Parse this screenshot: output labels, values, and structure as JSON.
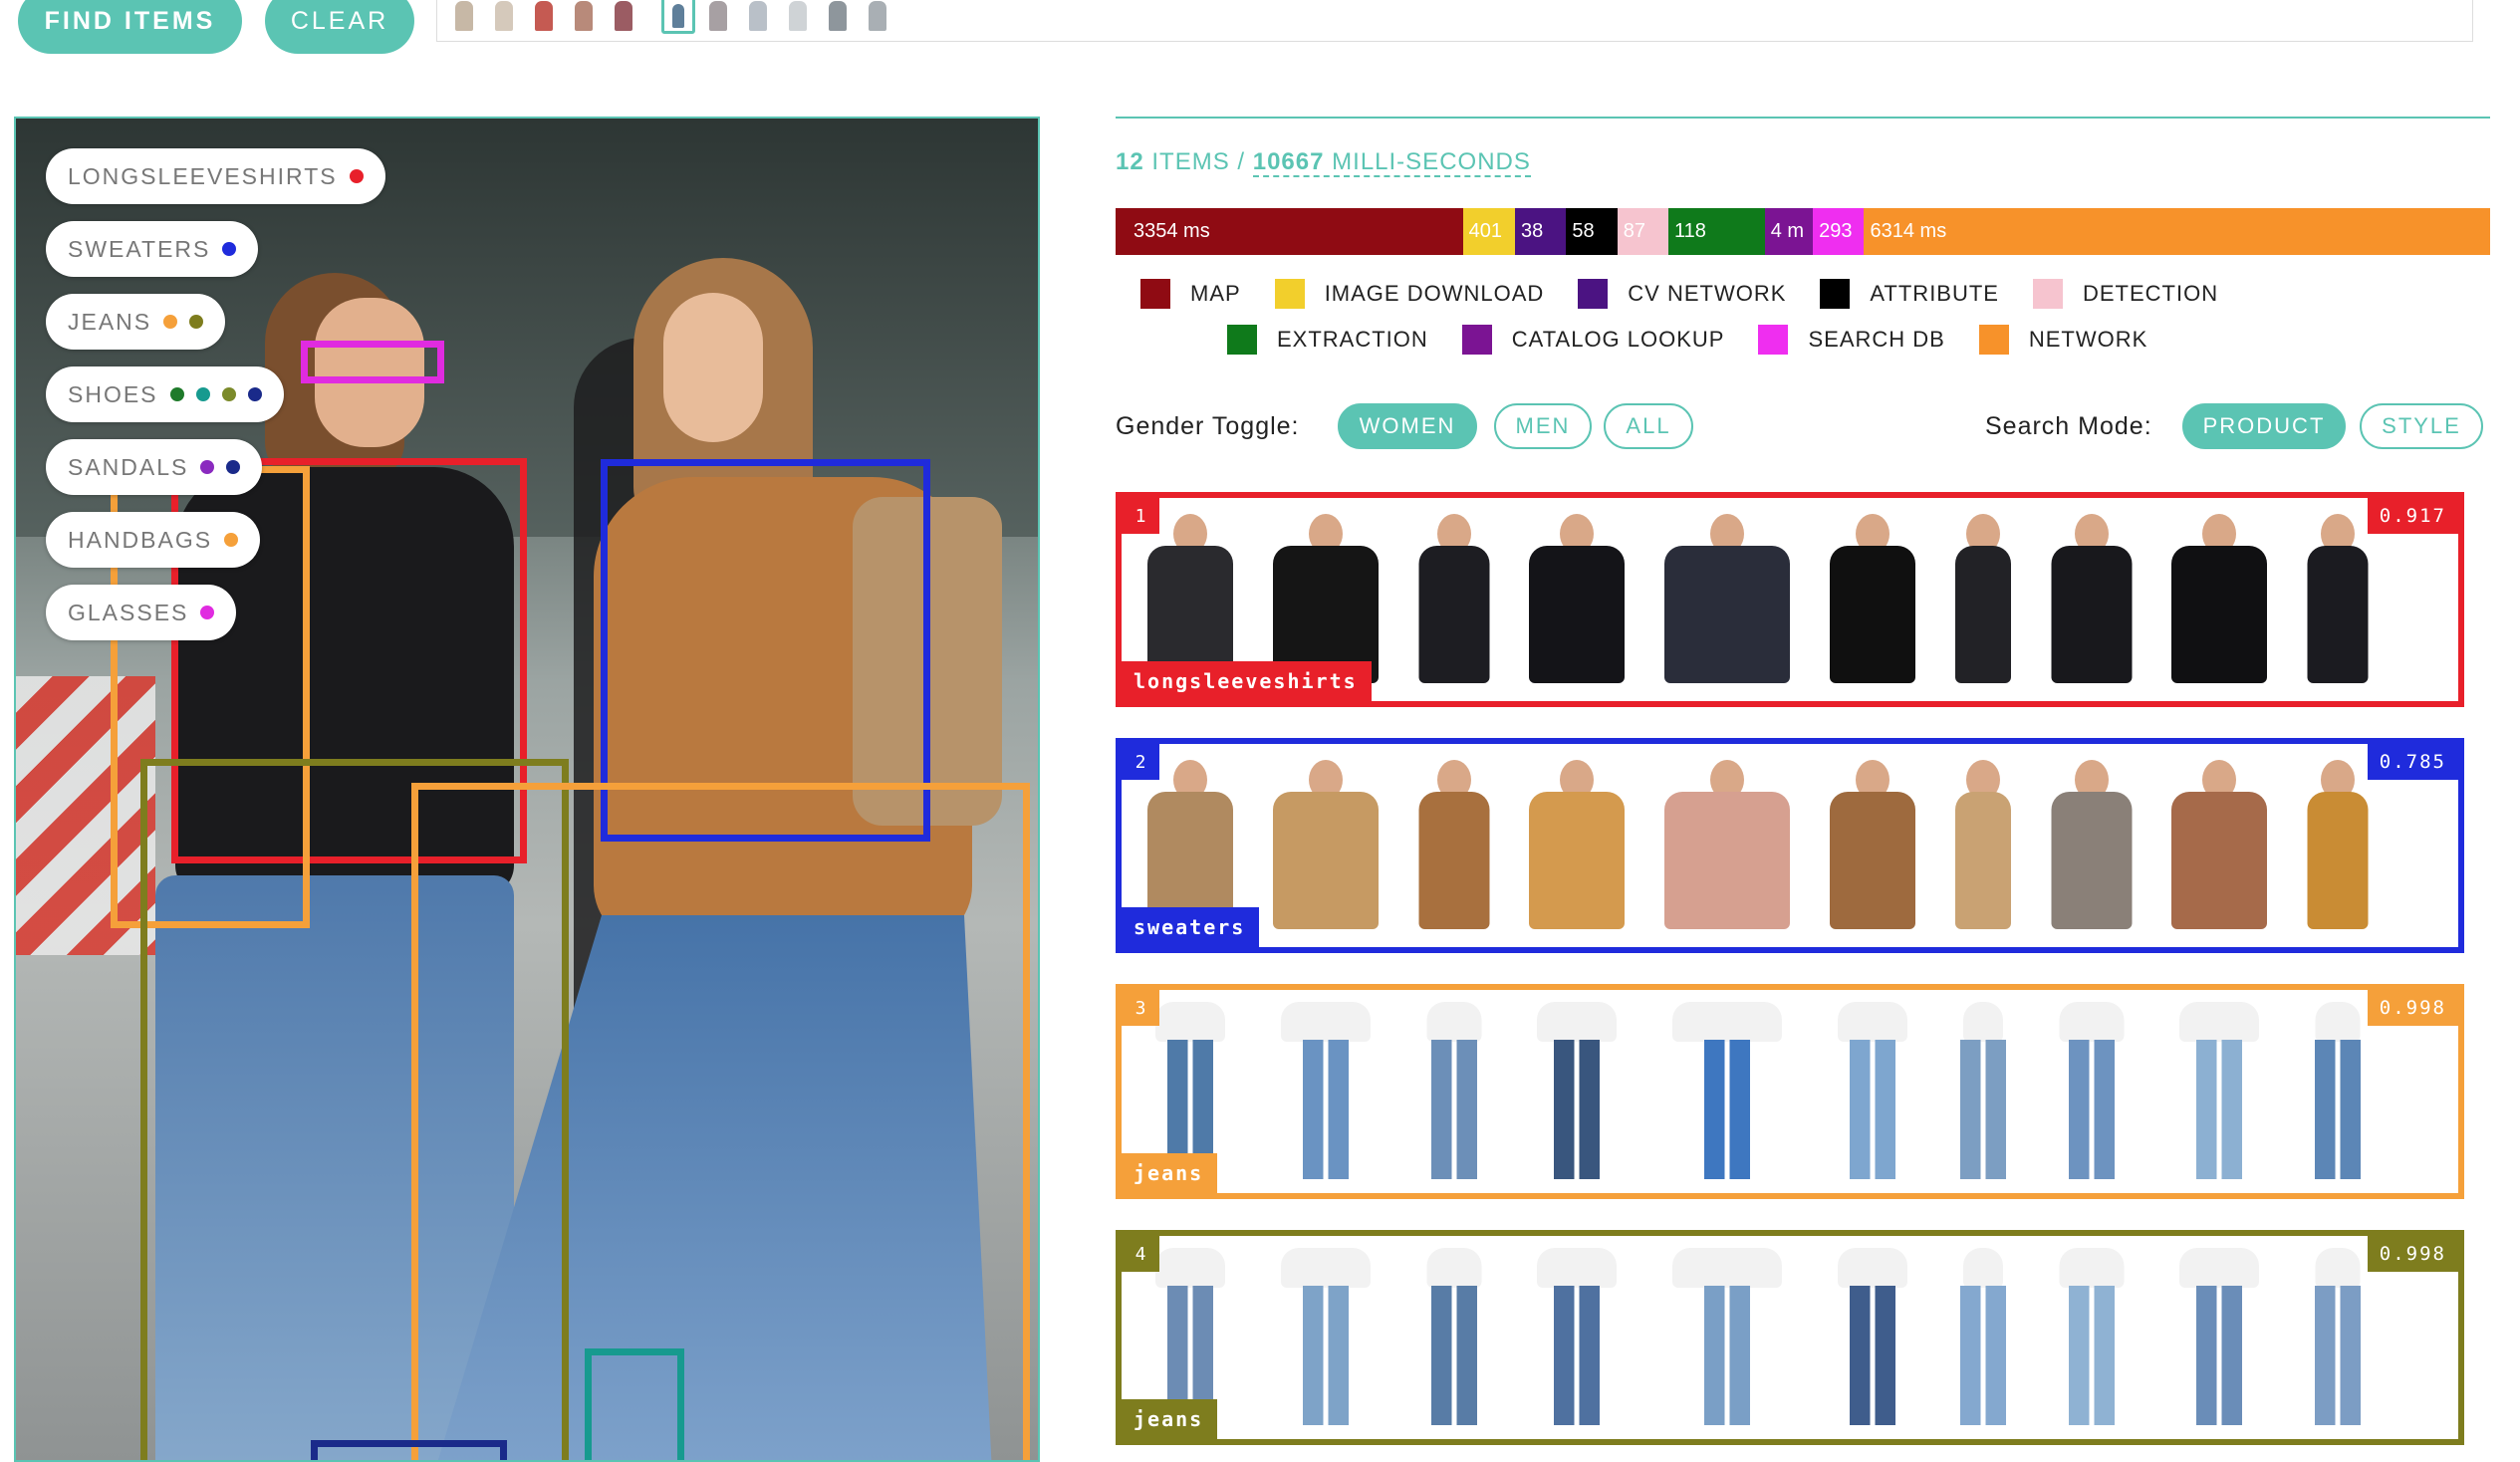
{
  "toolbar": {
    "find_label": "FIND ITEMS",
    "clear_label": "CLEAR"
  },
  "thumbnails": [
    {
      "name": "thumb-outfit-1",
      "color": "#c7b8a6",
      "selected": false
    },
    {
      "name": "thumb-outfit-2",
      "color": "#d5c9bb",
      "selected": false
    },
    {
      "name": "thumb-outfit-3",
      "color": "#c55a52",
      "selected": false
    },
    {
      "name": "thumb-outfit-4",
      "color": "#b88a7a",
      "selected": false
    },
    {
      "name": "thumb-outfit-5",
      "color": "#9b5c63",
      "selected": false
    },
    {
      "name": "thumb-outfit-6",
      "color": "#5f7f9a",
      "selected": true
    },
    {
      "name": "thumb-outfit-7",
      "color": "#a7a0a3",
      "selected": false
    },
    {
      "name": "thumb-outfit-8",
      "color": "#b9c0c8",
      "selected": false
    },
    {
      "name": "thumb-outfit-9",
      "color": "#cfd3d6",
      "selected": false
    },
    {
      "name": "thumb-outfit-10",
      "color": "#8e969c",
      "selected": false
    },
    {
      "name": "thumb-outfit-11",
      "color": "#a9afb4",
      "selected": false
    }
  ],
  "categories": [
    {
      "label": "LONGSLEEVESHIRTS",
      "dots": [
        "#e8202a"
      ]
    },
    {
      "label": "SWEATERS",
      "dots": [
        "#1f2bdc"
      ]
    },
    {
      "label": "JEANS",
      "dots": [
        "#f5a03a",
        "#7e7d1e"
      ]
    },
    {
      "label": "SHOES",
      "dots": [
        "#1e7a2a",
        "#179a8f",
        "#7b8a2a",
        "#1a2a8a"
      ]
    },
    {
      "label": "SANDALS",
      "dots": [
        "#8a2abf",
        "#1a2a8a"
      ]
    },
    {
      "label": "HANDBAGS",
      "dots": [
        "#f5a03a"
      ]
    },
    {
      "label": "GLASSES",
      "dots": [
        "#e02be0"
      ]
    }
  ],
  "summary": {
    "items_count": "12",
    "items_label": "ITEMS",
    "sep": "/",
    "ms_value": "10667",
    "ms_label": "MILLI-SECONDS"
  },
  "timing": [
    {
      "name": "map",
      "label": "3354 ms",
      "color": "#8f0b13",
      "weight": 3354
    },
    {
      "name": "image-download",
      "label": "401",
      "color": "#f2cf2c",
      "weight": 470
    },
    {
      "name": "cv-network",
      "label": "38",
      "color": "#4b1382",
      "weight": 460
    },
    {
      "name": "attribute",
      "label": "58",
      "color": "#000000",
      "weight": 460
    },
    {
      "name": "detection",
      "label": "87",
      "color": "#f6c4cf",
      "weight": 460
    },
    {
      "name": "extraction",
      "label": "118",
      "color": "#0f7a1b",
      "weight": 920
    },
    {
      "name": "catalog-lookup",
      "label": "4 m",
      "color": "#7b1493",
      "weight": 430
    },
    {
      "name": "search-db",
      "label": "293",
      "color": "#ef2ef0",
      "weight": 460
    },
    {
      "name": "network",
      "label": "6314 ms",
      "color": "#f7922a",
      "weight": 6314
    }
  ],
  "legend": [
    {
      "label": "MAP",
      "color": "#8f0b13"
    },
    {
      "label": "IMAGE DOWNLOAD",
      "color": "#f2cf2c"
    },
    {
      "label": "CV NETWORK",
      "color": "#4b1382"
    },
    {
      "label": "ATTRIBUTE",
      "color": "#000000"
    },
    {
      "label": "DETECTION",
      "color": "#f6c4cf"
    },
    {
      "label": "EXTRACTION",
      "color": "#0f7a1b"
    },
    {
      "label": "CATALOG LOOKUP",
      "color": "#7b1493"
    },
    {
      "label": "SEARCH DB",
      "color": "#ef2ef0"
    },
    {
      "label": "NETWORK",
      "color": "#f7922a"
    }
  ],
  "gender": {
    "label": "Gender Toggle:",
    "options": [
      "WOMEN",
      "MEN",
      "ALL"
    ],
    "selected": "WOMEN"
  },
  "search_mode": {
    "label": "Search Mode:",
    "options": [
      "PRODUCT",
      "STYLE"
    ],
    "selected": "PRODUCT"
  },
  "results": [
    {
      "index": "1",
      "name": "longsleeveshirts",
      "score": "0.917",
      "color": "#e8202a",
      "products": [
        "#2a2a2e",
        "#151515",
        "#1d1d22",
        "#141418",
        "#2a2d3a",
        "#101010",
        "#222226",
        "#18181c",
        "#101012",
        "#1b1b20"
      ]
    },
    {
      "index": "2",
      "name": "sweaters",
      "score": "0.785",
      "color": "#1f2bdc",
      "products": [
        "#b08a60",
        "#c69a63",
        "#a8703e",
        "#d49a4e",
        "#d6a090",
        "#9e6a3e",
        "#c9a273",
        "#8a8078",
        "#a66a4a",
        "#c98c34"
      ]
    },
    {
      "index": "3",
      "name": "jeans",
      "score": "0.998",
      "color": "#f5a03a",
      "products": [
        "#4f7aa8",
        "#6a93c2",
        "#6c8fb8",
        "#39567e",
        "#3e77c0",
        "#7ea6cf",
        "#7c9ec2",
        "#6d93c0",
        "#8cb0d2",
        "#5c86b6"
      ]
    },
    {
      "index": "4",
      "name": "jeans",
      "score": "0.998",
      "color": "#7e7d1e",
      "products": [
        "#6c8cb4",
        "#7ea3c8",
        "#587ca6",
        "#4f71a0",
        "#7a9fc6",
        "#3f5d8c",
        "#84a8cf",
        "#8fb2d3",
        "#6a8db8",
        "#7c9dc4"
      ]
    }
  ]
}
